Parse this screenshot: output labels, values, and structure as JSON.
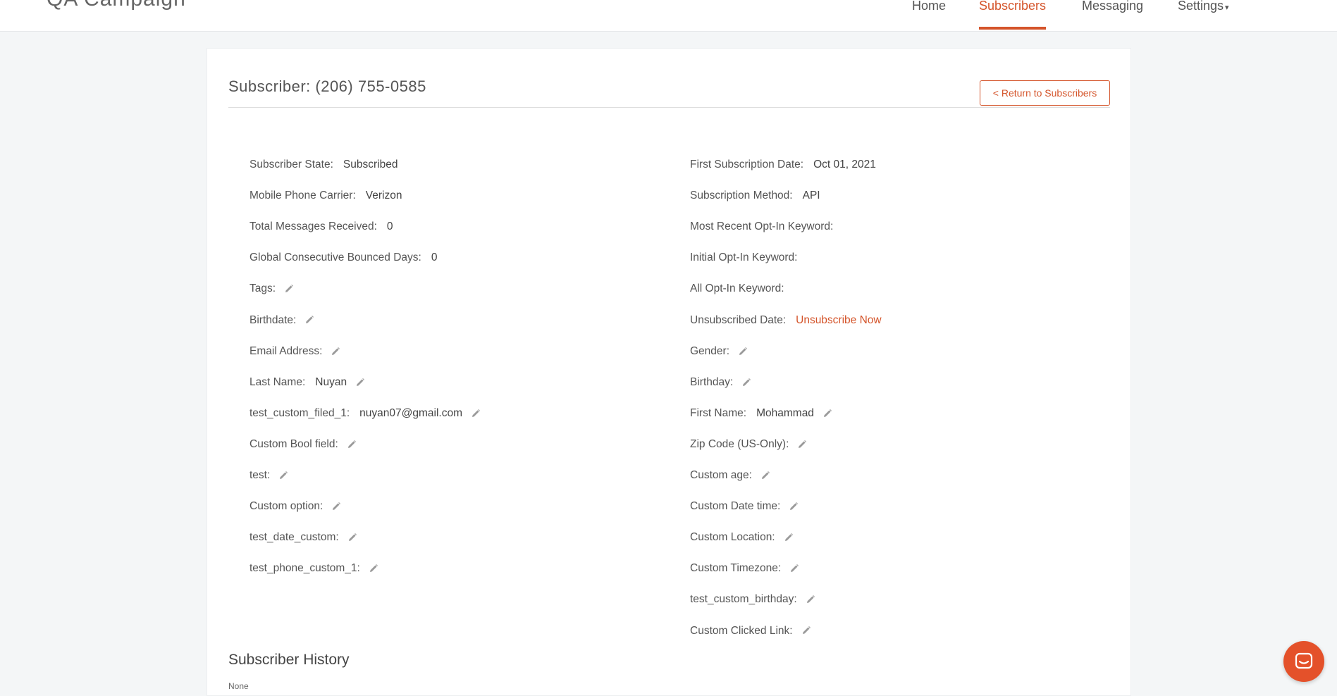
{
  "app": {
    "brand": "QA Campaign"
  },
  "nav": {
    "home": "Home",
    "subscribers": "Subscribers",
    "messaging": "Messaging",
    "settings": "Settings",
    "settings_caret": "▾"
  },
  "page": {
    "title": "Subscriber: (206) 755-0585",
    "return_button": "< Return to Subscribers"
  },
  "left_fields": [
    {
      "label": "Subscriber State:",
      "value": "Subscribed",
      "editable": false
    },
    {
      "label": "Mobile Phone Carrier:",
      "value": "Verizon",
      "editable": false
    },
    {
      "label": "Total Messages Received:",
      "value": "0",
      "editable": false
    },
    {
      "label": "Global Consecutive Bounced Days:",
      "value": "0",
      "editable": false
    },
    {
      "label": "Tags:",
      "value": "",
      "editable": true
    },
    {
      "label": "Birthdate:",
      "value": "",
      "editable": true
    },
    {
      "label": "Email Address:",
      "value": "",
      "editable": true
    },
    {
      "label": "Last Name:",
      "value": "Nuyan",
      "editable": true
    },
    {
      "label": "test_custom_filed_1:",
      "value": "nuyan07@gmail.com",
      "editable": true
    },
    {
      "label": "Custom Bool field:",
      "value": "",
      "editable": true
    },
    {
      "label": "test:",
      "value": "",
      "editable": true
    },
    {
      "label": "Custom option:",
      "value": "",
      "editable": true
    },
    {
      "label": "test_date_custom:",
      "value": "",
      "editable": true
    },
    {
      "label": "test_phone_custom_1:",
      "value": "",
      "editable": true
    }
  ],
  "right_fields": [
    {
      "label": "First Subscription Date:",
      "value": "Oct 01, 2021",
      "editable": false
    },
    {
      "label": "Subscription Method:",
      "value": "API",
      "editable": false
    },
    {
      "label": "Most Recent Opt-In Keyword:",
      "value": "",
      "editable": false
    },
    {
      "label": "Initial Opt-In Keyword:",
      "value": "",
      "editable": false
    },
    {
      "label": "All Opt-In Keyword:",
      "value": "",
      "editable": false
    },
    {
      "label": "Unsubscribed Date:",
      "value": "Unsubscribe Now",
      "editable": false
    },
    {
      "label": "Gender:",
      "value": "",
      "editable": true
    },
    {
      "label": "Birthday:",
      "value": "",
      "editable": true
    },
    {
      "label": "First Name:",
      "value": "Mohammad",
      "editable": true
    },
    {
      "label": "Zip Code (US-Only):",
      "value": "",
      "editable": true
    },
    {
      "label": "Custom age:",
      "value": "",
      "editable": true
    },
    {
      "label": "Custom Date time:",
      "value": "",
      "editable": true
    },
    {
      "label": "Custom Location:",
      "value": "",
      "editable": true
    },
    {
      "label": "Custom Timezone:",
      "value": "",
      "editable": true
    },
    {
      "label": "test_custom_birthday:",
      "value": "",
      "editable": true
    },
    {
      "label": "Custom Clicked Link:",
      "value": "",
      "editable": true
    }
  ],
  "history": {
    "title": "Subscriber History",
    "subtitle": "None"
  },
  "icons": {
    "edit": "pencil-icon",
    "chat": "chat-icon"
  },
  "colors": {
    "accent": "#d4542a",
    "chat": "#e4512a"
  }
}
